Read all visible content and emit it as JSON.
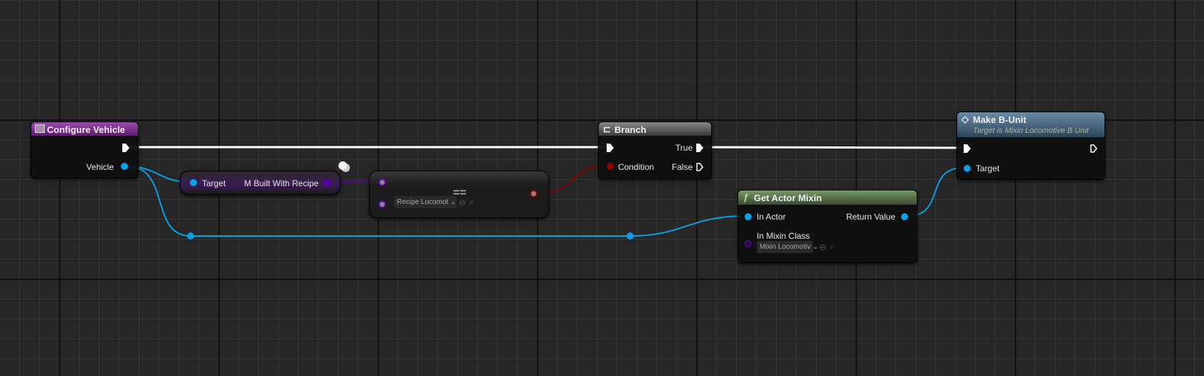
{
  "nodes": {
    "configure_vehicle": {
      "title": "Configure Vehicle",
      "output": "Vehicle"
    },
    "built_with_recipe": {
      "input": "Target",
      "output": "M Built With Recipe"
    },
    "equals": {
      "operator": "==",
      "dropdown": "Recipe Locomot"
    },
    "branch": {
      "title": "Branch",
      "condition": "Condition",
      "true_label": "True",
      "false_label": "False"
    },
    "get_actor_mixin": {
      "title": "Get Actor Mixin",
      "in_actor": "In Actor",
      "in_mixin_class": "In Mixin Class",
      "dropdown": "Mixin Locomotiv",
      "return_value": "Return Value"
    },
    "make_b_unit": {
      "title": "Make B-Unit",
      "subtitle": "Target is Mixin Locomotive B Unit",
      "target": "Target"
    }
  },
  "colors": {
    "object": "#0aa0e8",
    "exec": "#ffffff",
    "bool": "#8c0000",
    "class": "#5a00b0",
    "event_header": "#7a2a8c",
    "function_header": "#5a7a48",
    "call_header": "#4e6d88"
  }
}
